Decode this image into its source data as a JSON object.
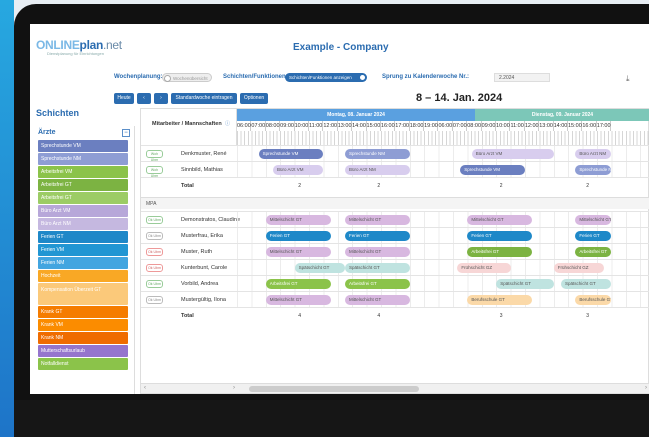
{
  "app": {
    "logo": {
      "a": "ONLINE",
      "b": "plan",
      "c": ".net",
      "tagline": "Dienstplanung für Einrichtungen"
    },
    "title": "Example - Company"
  },
  "toolbar": {
    "wochenplanung_label": "Wochenplanung:",
    "wochenplanung_toggle": "Wochenübersicht",
    "schichten_label": "Schichten/Funktionen:",
    "schichten_toggle": "Schichten/Funktionen anzeigen",
    "sprung_label": "Sprung zu Kalenderwoche Nr.:",
    "kw_value": "2.2024",
    "download_icon": "download-icon"
  },
  "nav": {
    "heute": "Heute",
    "prev": "‹",
    "next": "›",
    "standard": "Standardwoche eintragen",
    "optionen": "Optionen",
    "range": "8 – 14. Jan. 2024"
  },
  "sidebar": {
    "title": "Schichten",
    "group": "Ärzte",
    "items": [
      {
        "label": "Sprechstunde VM",
        "color": "#6b7fc0"
      },
      {
        "label": "Sprechstunde NM",
        "color": "#8e9dd4"
      },
      {
        "label": "Arbeitsfrei VM",
        "color": "#8bc34a"
      },
      {
        "label": "Arbeitsfrei GT",
        "color": "#7cb342"
      },
      {
        "label": "Arbeitsfrei GT",
        "color": "#9ccc65"
      },
      {
        "label": "Büro Arzt VM",
        "color": "#b7a7d9"
      },
      {
        "label": "Büro Arzt NM",
        "color": "#c5b8e0"
      },
      {
        "label": "Ferien GT",
        "color": "#1e88c8"
      },
      {
        "label": "Ferien VM",
        "color": "#2196d3"
      },
      {
        "label": "Ferien NM",
        "color": "#42a5e0"
      },
      {
        "label": "Hochzeit",
        "color": "#f9a825"
      },
      {
        "label": "Kompensation Überzeit GT",
        "color": "#fbc97a"
      },
      {
        "label": "Krank GT",
        "color": "#f57c00"
      },
      {
        "label": "Krank VM",
        "color": "#fb8c00"
      },
      {
        "label": "Krank NM",
        "color": "#ef6c00"
      },
      {
        "label": "Mutterschaftsurlaub",
        "color": "#9575cd"
      },
      {
        "label": "Notfalldienst",
        "color": "#8bc34a"
      }
    ]
  },
  "grid": {
    "header_label": "Mitarbeiter / Mannschaften",
    "info_icon": "info-icon",
    "days": [
      {
        "label": "Montag, 08. Januar 2024",
        "color": "#5aa0e0"
      },
      {
        "label": "Dienstag, 09. Januar 2024",
        "color": "#7cc7b8"
      }
    ],
    "hours": [
      "06:00",
      "07:00",
      "08:00",
      "09:00",
      "10:00",
      "11:00",
      "12:00",
      "13:00",
      "14:00",
      "15:00",
      "16:00",
      "17:00",
      "18:00",
      "19:00",
      "06:00",
      "07:00",
      "08:00",
      "09:00",
      "10:00",
      "11:00",
      "12:00",
      "13:00",
      "14:00",
      "15:00",
      "16:00",
      "17:00"
    ],
    "group_mpa": "MPA",
    "rows_a": [
      {
        "badge": "Woh Ubm",
        "badge_style": "",
        "name": "Denkmuster, René",
        "bars": [
          {
            "text": "Sprechstunde VM",
            "color": "#6b7fc0",
            "fg": "#fff",
            "day": 0,
            "start": 7.5,
            "end": 12
          },
          {
            "text": "Sprechstunde NM",
            "color": "#8e9dd4",
            "fg": "#fff",
            "day": 0,
            "start": 13.5,
            "end": 18
          },
          {
            "text": "Büro Arzt VM",
            "color": "#d8cdee",
            "fg": "#555",
            "day": 1,
            "start": 8.3,
            "end": 14
          },
          {
            "text": "Büro Arzt NM",
            "color": "#d8cdee",
            "fg": "#555",
            "day": 1,
            "start": 15.5,
            "end": 18
          }
        ]
      },
      {
        "badge": "Woh Ubm",
        "badge_style": "",
        "name": "Sinnbild, Mathias",
        "bars": [
          {
            "text": "Büro Arzt VM",
            "color": "#d8cdee",
            "fg": "#555",
            "day": 0,
            "start": 8.5,
            "end": 12
          },
          {
            "text": "Büro Arzt NM",
            "color": "#d8cdee",
            "fg": "#555",
            "day": 0,
            "start": 13.5,
            "end": 18
          },
          {
            "text": "Sprechstunde VM",
            "color": "#6b7fc0",
            "fg": "#fff",
            "day": 1,
            "start": 7.5,
            "end": 12
          },
          {
            "text": "Sprechstunde NM",
            "color": "#8e9dd4",
            "fg": "#fff",
            "day": 1,
            "start": 15.5,
            "end": 18
          }
        ]
      }
    ],
    "total_a": {
      "name": "Total",
      "nums": [
        "2",
        "2",
        "2",
        "2"
      ]
    },
    "rows_b": [
      {
        "badge": "Ok Ubm",
        "badge_style": "",
        "name": "Demonstratos, Claudine",
        "bars": [
          {
            "text": "Mittelschicht GT",
            "color": "#d8b8e0",
            "fg": "#555",
            "day": 0,
            "start": 8,
            "end": 12.5
          },
          {
            "text": "Mittelschicht GT",
            "color": "#d8b8e0",
            "fg": "#555",
            "day": 0,
            "start": 13.5,
            "end": 18
          },
          {
            "text": "Mittelschicht GT",
            "color": "#d8b8e0",
            "fg": "#555",
            "day": 1,
            "start": 8,
            "end": 12.5
          },
          {
            "text": "Mittelschicht GT",
            "color": "#d8b8e0",
            "fg": "#555",
            "day": 1,
            "start": 15.5,
            "end": 18
          }
        ]
      },
      {
        "badge": "Ok Ubm",
        "badge_style": "grey",
        "name": "Musterfrau, Erika",
        "bars": [
          {
            "text": "Ferien GT",
            "color": "#1e88c8",
            "fg": "#fff",
            "day": 0,
            "start": 8,
            "end": 12.5
          },
          {
            "text": "Ferien GT",
            "color": "#1e88c8",
            "fg": "#fff",
            "day": 0,
            "start": 13.5,
            "end": 18
          },
          {
            "text": "Ferien GT",
            "color": "#1e88c8",
            "fg": "#fff",
            "day": 1,
            "start": 8,
            "end": 12.5
          },
          {
            "text": "Ferien GT",
            "color": "#1e88c8",
            "fg": "#fff",
            "day": 1,
            "start": 15.5,
            "end": 18
          }
        ]
      },
      {
        "badge": "Ok Ubm",
        "badge_style": "red",
        "name": "Muster, Ruth",
        "bars": [
          {
            "text": "Mittelschicht GT",
            "color": "#d8b8e0",
            "fg": "#555",
            "day": 0,
            "start": 8,
            "end": 12.5
          },
          {
            "text": "Mittelschicht GT",
            "color": "#d8b8e0",
            "fg": "#555",
            "day": 0,
            "start": 13.5,
            "end": 18
          },
          {
            "text": "Arbeitsfrei GT",
            "color": "#7cb342",
            "fg": "#fff",
            "day": 1,
            "start": 8,
            "end": 12.5
          },
          {
            "text": "Arbeitsfrei GT",
            "color": "#7cb342",
            "fg": "#fff",
            "day": 1,
            "start": 15.5,
            "end": 18
          }
        ]
      },
      {
        "badge": "Ok Ubm",
        "badge_style": "red",
        "name": "Kunterbunt, Carole",
        "bars": [
          {
            "text": "Spätschicht GT",
            "color": "#bfe3e0",
            "fg": "#555",
            "day": 0,
            "start": 10,
            "end": 13.5
          },
          {
            "text": "Spätschicht GT",
            "color": "#bfe3e0",
            "fg": "#555",
            "day": 0,
            "start": 13.5,
            "end": 18
          },
          {
            "text": "Frühschicht GZ",
            "color": "#f7d6d6",
            "fg": "#555",
            "day": 1,
            "start": 7.3,
            "end": 11
          },
          {
            "text": "Frühschicht GZ",
            "color": "#f7d6d6",
            "fg": "#555",
            "day": 1,
            "start": 14,
            "end": 17.5
          }
        ]
      },
      {
        "badge": "Ok Ubm",
        "badge_style": "",
        "name": "Vorbild, Andrea",
        "bars": [
          {
            "text": "Arbeitsfrei GT",
            "color": "#8bc34a",
            "fg": "#fff",
            "day": 0,
            "start": 8,
            "end": 12.5
          },
          {
            "text": "Arbeitsfrei GT",
            "color": "#8bc34a",
            "fg": "#fff",
            "day": 0,
            "start": 13.5,
            "end": 18
          },
          {
            "text": "Spätschicht GT",
            "color": "#bfe3e0",
            "fg": "#555",
            "day": 1,
            "start": 10,
            "end": 14
          },
          {
            "text": "Spätschicht GT",
            "color": "#bfe3e0",
            "fg": "#555",
            "day": 1,
            "start": 14.5,
            "end": 18
          }
        ]
      },
      {
        "badge": "Ok Ubm",
        "badge_style": "grey",
        "name": "Mustergültig, Ilona",
        "bars": [
          {
            "text": "Mittelschicht GT",
            "color": "#d8b8e0",
            "fg": "#555",
            "day": 0,
            "start": 8,
            "end": 12.5
          },
          {
            "text": "Mittelschicht GT",
            "color": "#d8b8e0",
            "fg": "#555",
            "day": 0,
            "start": 13.5,
            "end": 18
          },
          {
            "text": "Berufsschule GT",
            "color": "#fbd9a8",
            "fg": "#555",
            "day": 1,
            "start": 8,
            "end": 12.5
          },
          {
            "text": "Berufsschule GT",
            "color": "#fbd9a8",
            "fg": "#555",
            "day": 1,
            "start": 15.5,
            "end": 18
          }
        ]
      }
    ],
    "total_b": {
      "name": "Total",
      "nums": [
        "4",
        "4",
        "3",
        "3"
      ]
    }
  }
}
